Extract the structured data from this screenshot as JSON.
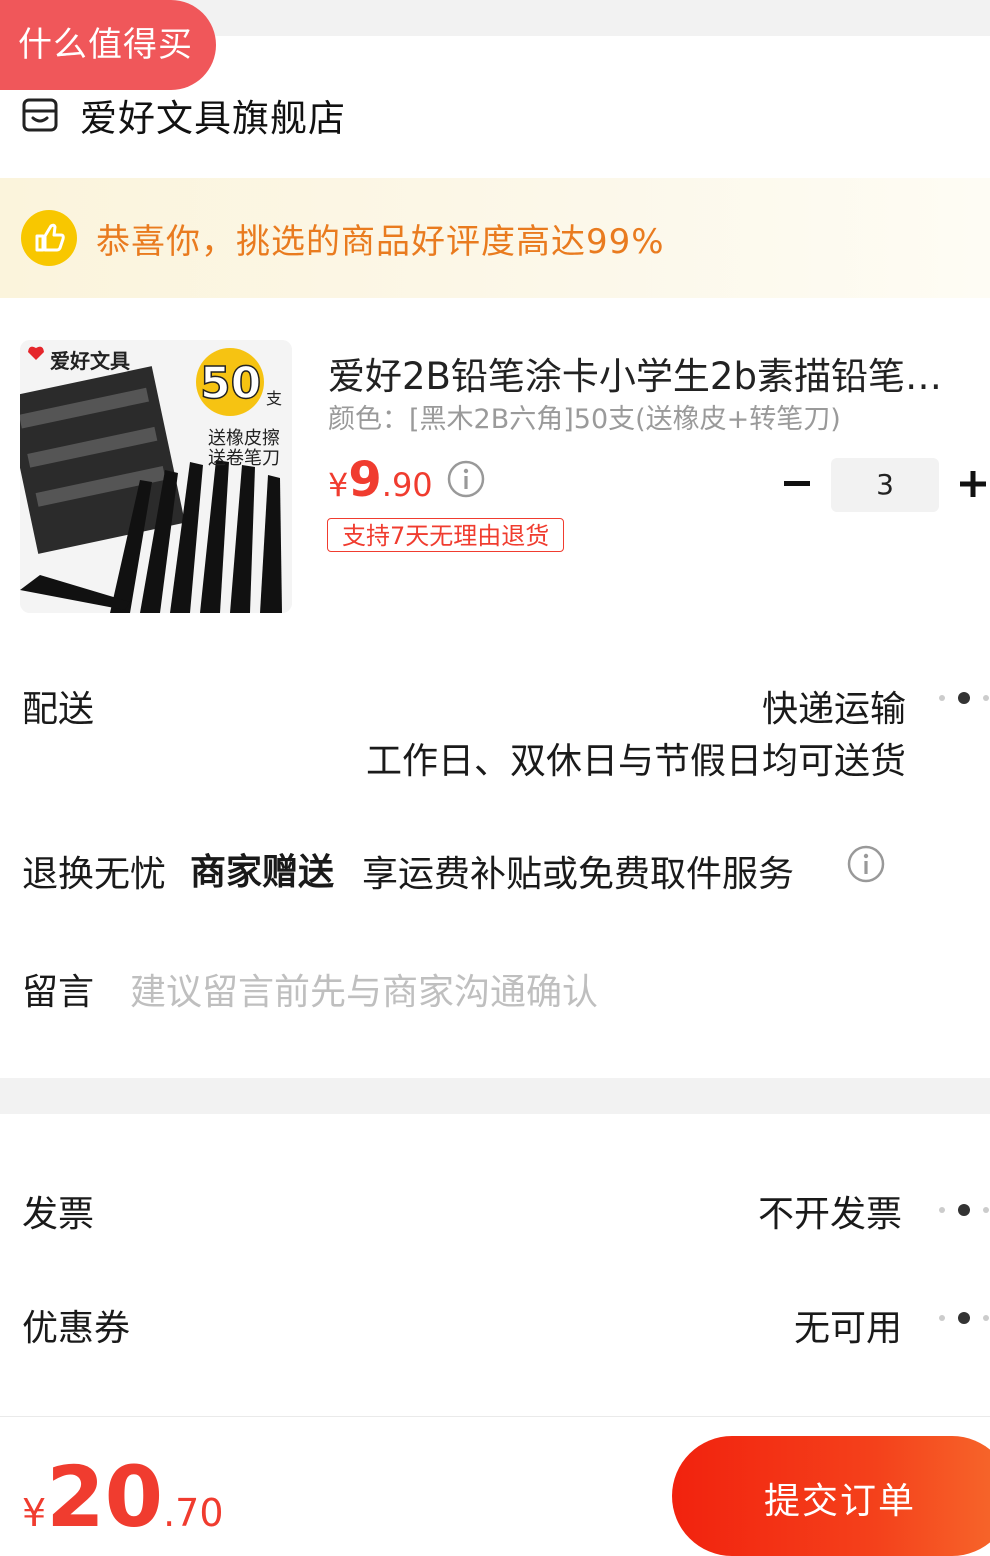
{
  "badge": "什么值得买",
  "store": {
    "name": "爱好文具旗舰店"
  },
  "banner": {
    "text": "恭喜你，挑选的商品好评度高达99%"
  },
  "product": {
    "title": "爱好2B铅笔涂卡小学生2b素描铅笔…",
    "spec": "颜色：[黑木2B六角]50支(送橡皮+转笔刀)",
    "price_symbol": "¥",
    "price_int": "9",
    "price_dec": ".90",
    "return_tag": "支持7天无理由退货",
    "quantity": "3",
    "image_texts": {
      "brand": "爱好文具",
      "count": "50",
      "unit": "支",
      "gift1": "送橡皮擦",
      "gift2": "送卷笔刀"
    }
  },
  "delivery": {
    "label": "配送",
    "method": "快递运输",
    "detail": "工作日、双休日与节假日均可送货"
  },
  "returns": {
    "label": "退换无忧",
    "merchant": "商家赠送",
    "detail": "享运费补贴或免费取件服务"
  },
  "message": {
    "label": "留言",
    "placeholder": "建议留言前先与商家沟通确认"
  },
  "invoice": {
    "label": "发票",
    "value": "不开发票"
  },
  "coupon": {
    "label": "优惠券",
    "value": "无可用"
  },
  "footer": {
    "price_symbol": "¥",
    "total_int": "20",
    "total_dec": ".70",
    "submit_label": "提交订单"
  },
  "colors": {
    "accent_red": "#f03c2f",
    "banner_orange": "#e97b1f",
    "badge_red": "#f0575a"
  }
}
